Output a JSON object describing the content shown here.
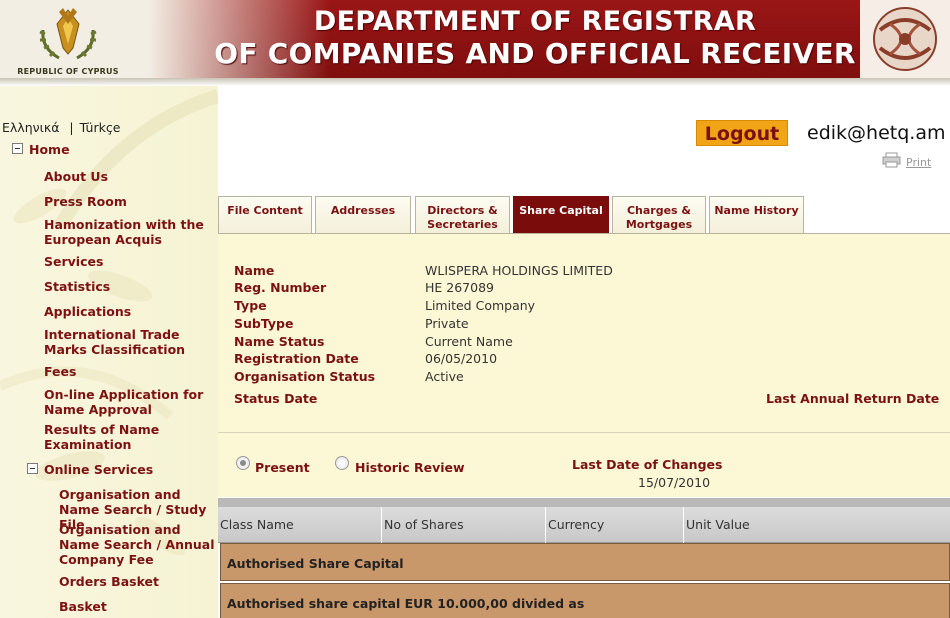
{
  "header": {
    "country_caption": "REPUBLIC OF CYPRUS",
    "title_line1": "DEPARTMENT OF REGISTRAR",
    "title_line2": "OF COMPANIES AND OFFICIAL RECEIVER"
  },
  "language": {
    "greek": "Ελληνικά",
    "separator": "|",
    "turkish": "Türkçe"
  },
  "sidebar": {
    "home": "Home",
    "items": [
      "About Us",
      "Press Room",
      "Hamonization with the European Acquis",
      "Services",
      "Statistics",
      "Applications",
      "International Trade Marks Classification",
      "Fees",
      "On-line Application for Name Approval",
      "Results of Name Examination"
    ],
    "online_services": "Online Services",
    "sub_items": [
      "Organisation and Name Search / Study File",
      "Organisation and Name Search / Annual Company Fee",
      "Orders Basket",
      "Basket"
    ]
  },
  "account": {
    "logout_label": "Logout",
    "user_email": "edik@hetq.am",
    "print_label": "Print"
  },
  "tabs": [
    {
      "label": "File Content",
      "active": false
    },
    {
      "label": "Addresses",
      "active": false
    },
    {
      "label": "Directors & Secretaries",
      "active": false
    },
    {
      "label": "Share Capital",
      "active": true
    },
    {
      "label": "Charges & Mortgages",
      "active": false
    },
    {
      "label": "Name History",
      "active": false
    }
  ],
  "company": {
    "name_label": "Name",
    "name_value": "WLISPERA HOLDINGS LIMITED",
    "reg_label": "Reg. Number",
    "reg_value": "HE 267089",
    "type_label": "Type",
    "type_value": "Limited Company",
    "subtype_label": "SubType",
    "subtype_value": "Private",
    "name_status_label": "Name Status",
    "name_status_value": "Current Name",
    "reg_date_label": "Registration Date",
    "reg_date_value": "06/05/2010",
    "org_status_label": "Organisation Status",
    "org_status_value": "Active",
    "status_date_label": "Status Date",
    "last_return_label": "Last Annual Return Date"
  },
  "view": {
    "present_label": "Present",
    "historic_label": "Historic Review",
    "selected": "Present",
    "last_changes_label": "Last Date of Changes",
    "last_changes_value": "15/07/2010"
  },
  "table": {
    "columns": [
      "Class Name",
      "No of Shares",
      "Currency",
      "Unit Value"
    ],
    "rows": [
      "Authorised Share Capital",
      "Authorised share capital EUR 10.000,00 divided as"
    ]
  },
  "colors": {
    "brand_red": "#7a0c0c",
    "sidebar_bg": "#f6f3d4",
    "panel_bg": "#fcf8d6",
    "logout_bg": "#f2a417",
    "row_bg": "#c9986a"
  }
}
